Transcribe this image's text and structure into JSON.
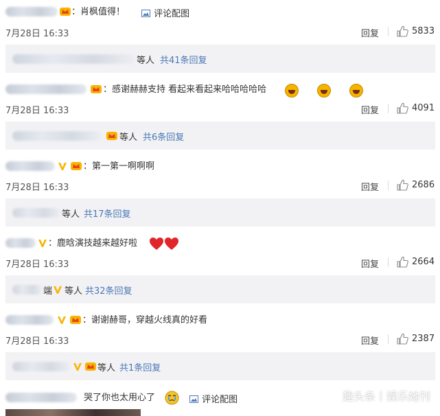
{
  "comments": [
    {
      "text": "：肖枫值得！",
      "time": "7月28日 16:33",
      "reply_label": "回复",
      "likes": "5833",
      "pic_link": "评论配图",
      "sub": {
        "suffix": "等人",
        "count": "共41条回复"
      }
    },
    {
      "text": "：感谢赫赫支持 看起来看起来哈哈哈哈哈",
      "time": "7月28日 16:33",
      "reply_label": "回复",
      "likes": "4091",
      "sub": {
        "suffix": "等人",
        "count": "共6条回复"
      }
    },
    {
      "text": "：第一第一啊啊啊",
      "time": "7月28日 16:33",
      "reply_label": "回复",
      "likes": "2686",
      "sub": {
        "suffix": "等人",
        "count": "共17条回复"
      }
    },
    {
      "text": "：鹿晗演技越来越好啦",
      "time": "7月28日 16:33",
      "reply_label": "回复",
      "likes": "2664",
      "sub": {
        "fragment": "端",
        "suffix": "等人",
        "count": "共32条回复"
      }
    },
    {
      "text": "：谢谢赫哥，穿越火线真的好看",
      "time": "7月28日 16:33",
      "reply_label": "回复",
      "likes": "2387",
      "sub": {
        "suffix": "等人",
        "count": "共1条回复"
      }
    },
    {
      "text": "哭了你也太用心了",
      "pic_link": "评论配图"
    }
  ],
  "watermark": "趣头条丨娱乐她刊",
  "colors": {
    "link": "#4a77b5",
    "sub_bg": "#f2f2f5",
    "verified": "#f7b500",
    "heart": "#e0262b"
  }
}
